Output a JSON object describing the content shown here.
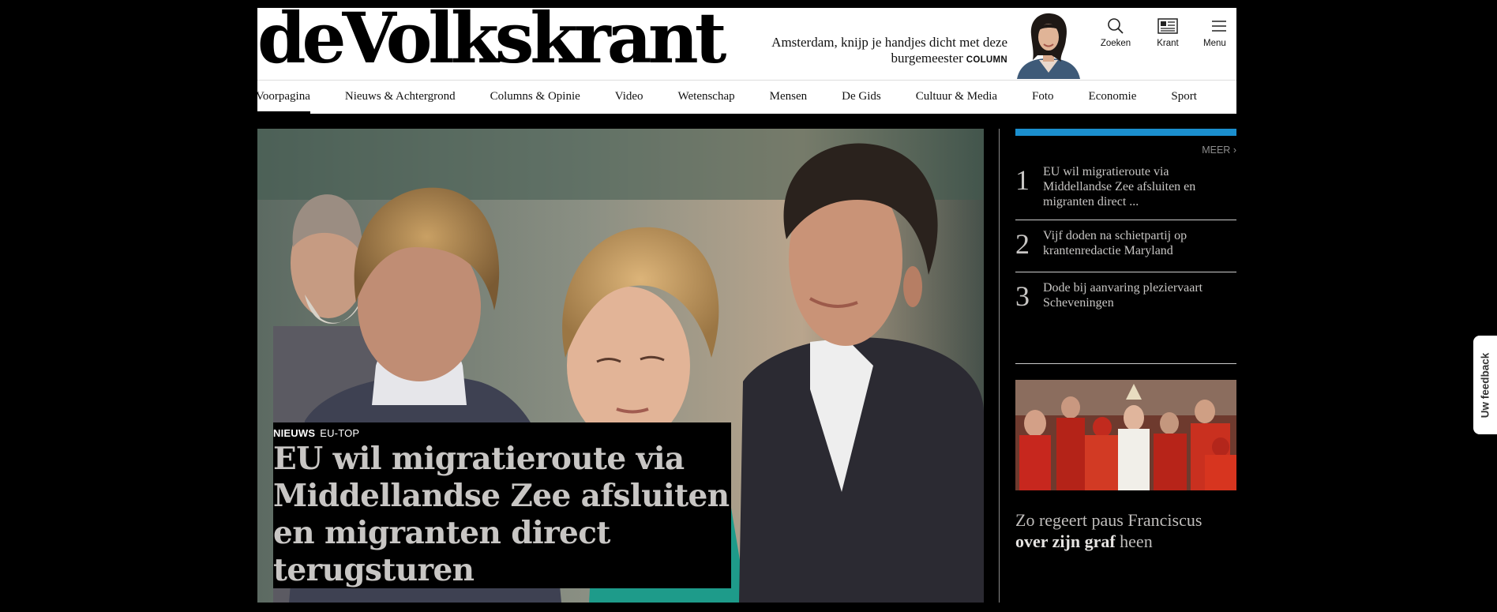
{
  "brand": {
    "logo": "deVolkskrant"
  },
  "header_teaser": {
    "text": "Amsterdam, knijp je handjes dicht met deze burgemeester",
    "kicker": "COLUMN"
  },
  "tools": [
    {
      "icon": "search-icon",
      "label": "Zoeken"
    },
    {
      "icon": "newspaper-icon",
      "label": "Krant"
    },
    {
      "icon": "menu-icon",
      "label": "Menu"
    }
  ],
  "nav": [
    {
      "label": "Voorpagina",
      "active": true
    },
    {
      "label": "Nieuws & Achtergrond"
    },
    {
      "label": "Columns & Opinie"
    },
    {
      "label": "Video"
    },
    {
      "label": "Wetenschap"
    },
    {
      "label": "Mensen"
    },
    {
      "label": "De Gids"
    },
    {
      "label": "Cultuur & Media"
    },
    {
      "label": "Foto"
    },
    {
      "label": "Economie"
    },
    {
      "label": "Sport"
    }
  ],
  "hero": {
    "section": "NIEUWS",
    "tag": "EU-TOP",
    "headline": "EU wil migratieroute via Middellandse Zee afsluiten en migranten direct terugsturen"
  },
  "sidebar": {
    "accent_color": "#1b8fce",
    "more": "MEER",
    "most_read": [
      {
        "rank": "1",
        "title": "EU wil migratieroute via Middellandse Zee afsluiten en migranten direct ..."
      },
      {
        "rank": "2",
        "title": "Vijf doden na schietpartij op krantenredactie Maryland"
      },
      {
        "rank": "3",
        "title": "Dode bij aanvaring plezier­vaart Scheveningen"
      }
    ],
    "feature": {
      "title_pre": "Zo regeert paus Franciscus",
      "title_bold": "over zijn graf",
      "title_post": "heen"
    }
  },
  "feedback": {
    "label": "Uw feedback"
  }
}
